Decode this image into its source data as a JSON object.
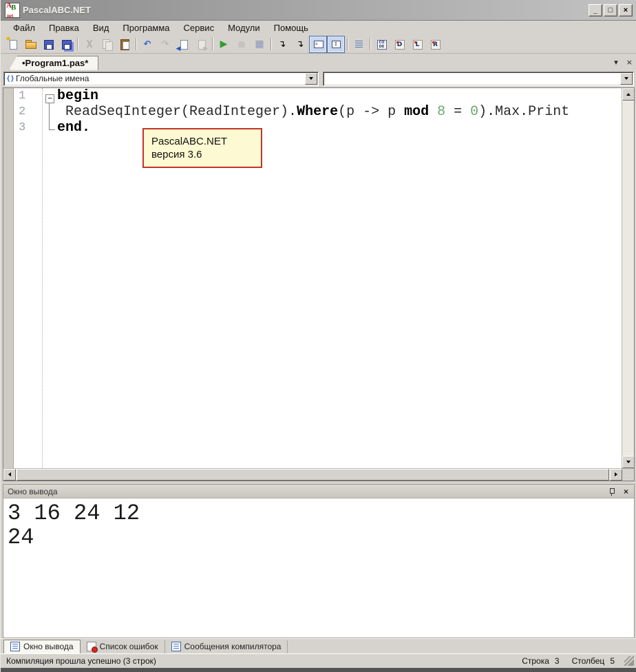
{
  "window": {
    "title": "PascalABC.NET",
    "logo_a": "A",
    "logo_b": "B",
    "logo_net": "net",
    "controls": {
      "minimize": "_",
      "maximize": "□",
      "close": "×"
    }
  },
  "menu": {
    "items": [
      "Файл",
      "Правка",
      "Вид",
      "Программа",
      "Сервис",
      "Модули",
      "Помощь"
    ]
  },
  "toolbar": {
    "buttons": [
      {
        "name": "new-file-button",
        "icon": "page-new"
      },
      {
        "name": "open-file-button",
        "icon": "folder"
      },
      {
        "name": "save-button",
        "icon": "floppy"
      },
      {
        "name": "save-all-button",
        "icon": "floppy-all"
      },
      {
        "sep": true
      },
      {
        "name": "cut-button",
        "icon": "scissors",
        "disabled": true
      },
      {
        "name": "copy-button",
        "icon": "copy",
        "disabled": true
      },
      {
        "name": "paste-button",
        "icon": "clipboard"
      },
      {
        "sep": true
      },
      {
        "name": "undo-button",
        "icon": "undo"
      },
      {
        "name": "redo-button",
        "icon": "redo",
        "disabled": true
      },
      {
        "name": "nav-back-button",
        "icon": "page-back"
      },
      {
        "name": "nav-forward-button",
        "icon": "page-forward",
        "disabled": true
      },
      {
        "sep": true
      },
      {
        "name": "run-button",
        "icon": "run"
      },
      {
        "name": "stop-button",
        "icon": "stop",
        "disabled": true
      },
      {
        "name": "compile-button",
        "icon": "grid"
      },
      {
        "sep": true
      },
      {
        "name": "indent-region-button",
        "icon": "step1"
      },
      {
        "name": "outdent-region-button",
        "icon": "step2"
      },
      {
        "name": "console-toggle",
        "icon": "console",
        "pressed": true
      },
      {
        "name": "input-panel-toggle",
        "icon": "textbox",
        "pressed": true
      },
      {
        "sep": true
      },
      {
        "name": "format-code-button",
        "icon": "list"
      },
      {
        "sep": true
      },
      {
        "name": "code-templates-button",
        "icon": "code"
      },
      {
        "name": "show-debug-window-button",
        "icon": "letter-D",
        "letter": "D"
      },
      {
        "name": "show-local-vars-button",
        "icon": "letter-L",
        "letter": "L"
      },
      {
        "name": "show-watch-window-button",
        "icon": "letter-R",
        "letter": "R"
      }
    ]
  },
  "tabstrip": {
    "tabs": [
      {
        "label": "•Program1.pas*",
        "active": true
      }
    ],
    "list_arrow": "▾",
    "close": "×"
  },
  "navigator": {
    "scope_icon": "{}",
    "scope_value": "Глобальные имена",
    "member_value": ""
  },
  "editor": {
    "fold_marker": "−",
    "lines": [
      {
        "num": "1",
        "tokens": [
          {
            "text": "begin",
            "cls": "kw"
          }
        ]
      },
      {
        "num": "2",
        "tokens": [
          {
            "text": " ReadSeqInteger(ReadInteger).",
            "cls": "plain"
          },
          {
            "text": "Where",
            "cls": "kw"
          },
          {
            "text": "(p -> p ",
            "cls": "plain"
          },
          {
            "text": "mod",
            "cls": "kw"
          },
          {
            "text": " ",
            "cls": "plain"
          },
          {
            "text": "8",
            "cls": "num"
          },
          {
            "text": " = ",
            "cls": "plain"
          },
          {
            "text": "0",
            "cls": "num"
          },
          {
            "text": ").Max.Print",
            "cls": "plain"
          }
        ]
      },
      {
        "num": "3",
        "tokens": [
          {
            "text": "end.",
            "cls": "kw"
          }
        ]
      }
    ]
  },
  "tooltip": {
    "title": "PascalABC.NET",
    "subtitle": "версия 3.6"
  },
  "output": {
    "title": "Окно вывода",
    "close": "×",
    "lines": [
      "3 16 24 12",
      "24"
    ]
  },
  "bottom_tabs": [
    {
      "label": "Окно вывода",
      "icon": "list",
      "active": true
    },
    {
      "label": "Список ошибок",
      "icon": "error",
      "active": false
    },
    {
      "label": "Сообщения компилятора",
      "icon": "list",
      "active": false
    }
  ],
  "status": {
    "message": "Компиляция прошла успешно (3 строк)",
    "line_label": "Строка",
    "line_value": "3",
    "col_label": "Столбец",
    "col_value": "5"
  },
  "colors": {
    "keyword": "#000000",
    "number_literal": "#6fa46f",
    "tooltip_bg": "#fdf9d2",
    "tooltip_border": "#c23428",
    "run_green": "#2f9e2f",
    "pressed_toggle_border": "#4a6b9b"
  }
}
